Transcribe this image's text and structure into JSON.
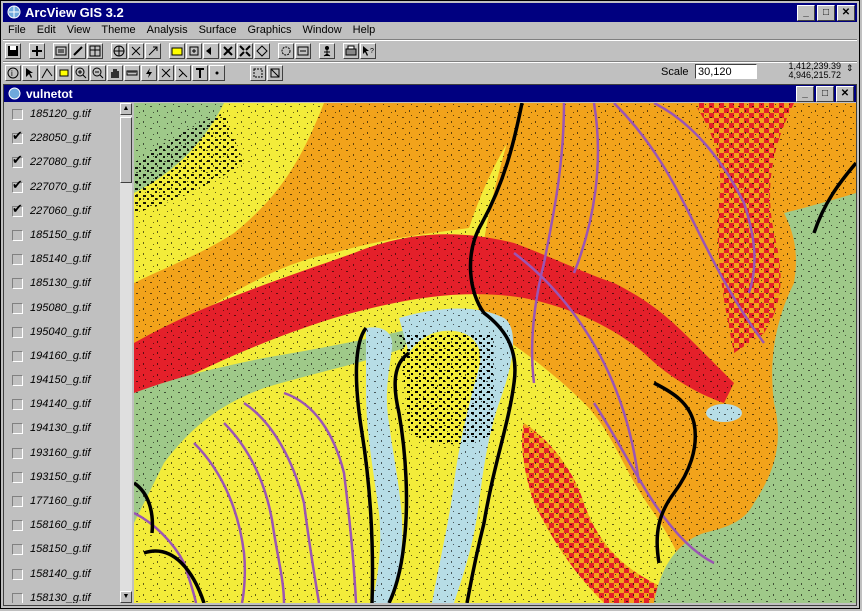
{
  "app": {
    "title": "ArcView GIS 3.2",
    "window_controls": [
      "_",
      "□",
      "✕"
    ]
  },
  "menu": [
    "File",
    "Edit",
    "View",
    "Theme",
    "Analysis",
    "Surface",
    "Graphics",
    "Window",
    "Help"
  ],
  "scale": {
    "label": "Scale",
    "value": "30,120"
  },
  "coords": {
    "x": "1,412,239.39",
    "y": "4,946,215.72"
  },
  "view_window": {
    "title": "vulnetot"
  },
  "toc": {
    "items": [
      {
        "label": "185120_g.tif",
        "checked": false
      },
      {
        "label": "228050_g.tif",
        "checked": true
      },
      {
        "label": "227080_g.tif",
        "checked": true
      },
      {
        "label": "227070_g.tif",
        "checked": true
      },
      {
        "label": "227060_g.tif",
        "checked": true
      },
      {
        "label": "185150_g.tif",
        "checked": false
      },
      {
        "label": "185140_g.tif",
        "checked": false
      },
      {
        "label": "185130_g.tif",
        "checked": false
      },
      {
        "label": "195080_g.tif",
        "checked": false
      },
      {
        "label": "195040_g.tif",
        "checked": false
      },
      {
        "label": "194160_g.tif",
        "checked": false
      },
      {
        "label": "194150_g.tif",
        "checked": false
      },
      {
        "label": "194140_g.tif",
        "checked": false
      },
      {
        "label": "194130_g.tif",
        "checked": false
      },
      {
        "label": "193160_g.tif",
        "checked": false
      },
      {
        "label": "193150_g.tif",
        "checked": false
      },
      {
        "label": "177160_g.tif",
        "checked": false
      },
      {
        "label": "158160_g.tif",
        "checked": false
      },
      {
        "label": "158150_g.tif",
        "checked": false
      },
      {
        "label": "158140_g.tif",
        "checked": false
      },
      {
        "label": "158130_g.tif",
        "checked": false
      }
    ]
  },
  "colors": {
    "titlebar": "#000080",
    "map_yellow": "#f3ec3a",
    "map_orange": "#f2a31b",
    "map_red": "#e4202a",
    "map_green": "#9fc989",
    "map_lightblue": "#b7dde6",
    "map_purple": "#9b55b4"
  }
}
